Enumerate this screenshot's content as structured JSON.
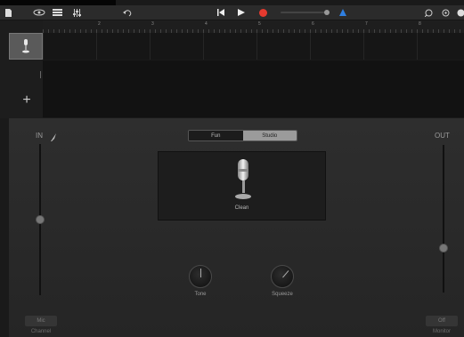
{
  "toolbar": {
    "icons": [
      "document-icon",
      "view-icon",
      "tracks-icon",
      "mixer-icon",
      "undo-icon",
      "go-to-start-icon",
      "play-icon",
      "record-icon",
      "metronome-icon",
      "loop-icon",
      "settings-icon"
    ]
  },
  "ruler": {
    "numbers": [
      "2",
      "3",
      "4",
      "5",
      "6",
      "7",
      "8"
    ]
  },
  "tracks": {
    "add_label": "+"
  },
  "panel": {
    "in_label": "IN",
    "out_label": "OUT",
    "tabs": {
      "fun": "Fun",
      "studio": "Studio",
      "selected": "Studio"
    },
    "mic_name": "Clean",
    "knobs": [
      {
        "label": "Tone",
        "value": 0.5
      },
      {
        "label": "Squeeze",
        "value": 0.65
      }
    ],
    "input_level": 0.5,
    "output_level": 0.3,
    "mic_button": "Mic",
    "channel_label": "Channel",
    "off_button": "Off",
    "monitor_label": "Monitor"
  },
  "colors": {
    "record": "#e53a2f",
    "metronome": "#2f7fe0",
    "studio_tab": "#9b9b9b"
  }
}
